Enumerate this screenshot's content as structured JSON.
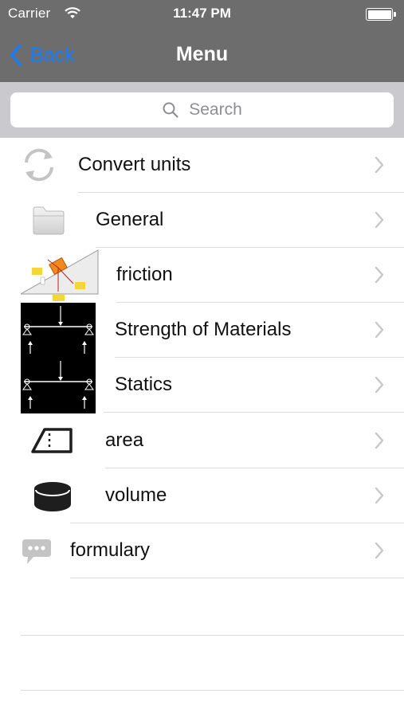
{
  "status_bar": {
    "carrier": "Carrier",
    "time": "11:47 PM"
  },
  "nav": {
    "back_label": "Back",
    "title": "Menu"
  },
  "search": {
    "placeholder": "Search"
  },
  "menu": {
    "items": [
      {
        "label": "Convert units",
        "icon": "refresh-icon"
      },
      {
        "label": "General",
        "icon": "folder-icon"
      },
      {
        "label": "friction",
        "icon": "friction-diagram-icon"
      },
      {
        "label": "Strength of Materials",
        "icon": "beam-diagram-icon"
      },
      {
        "label": "Statics",
        "icon": "beam-diagram-icon"
      },
      {
        "label": "area",
        "icon": "area-icon"
      },
      {
        "label": "volume",
        "icon": "cylinder-icon"
      },
      {
        "label": "formulary",
        "icon": "speech-bubble-icon"
      }
    ]
  },
  "colors": {
    "nav_background": "#6d6d6d",
    "accent": "#1a7cf5",
    "search_background": "#c9c9ce"
  }
}
